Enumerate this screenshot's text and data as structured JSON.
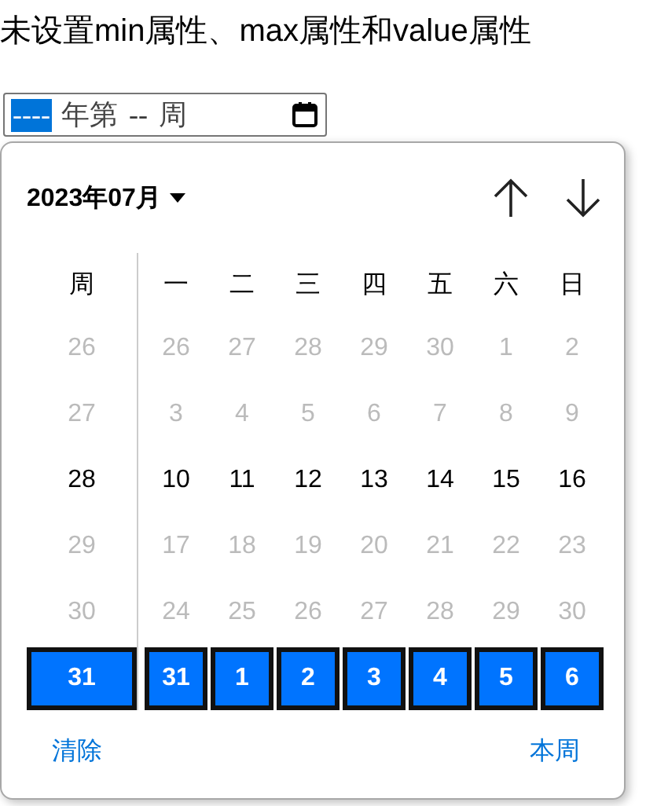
{
  "heading": "未设置min属性、max属性和value属性",
  "week_input": {
    "segments": [
      {
        "kind": "field",
        "text": "----",
        "selected": true
      },
      {
        "kind": "literal",
        "text": "年第"
      },
      {
        "kind": "field",
        "text": "--",
        "selected": false
      },
      {
        "kind": "literal",
        "text": "周"
      }
    ]
  },
  "picker": {
    "month_label": "2023年07月",
    "week_header": "周",
    "weekdays": [
      "一",
      "二",
      "三",
      "四",
      "五",
      "六",
      "日"
    ],
    "weeks": [
      {
        "week": "26",
        "days": [
          "26",
          "27",
          "28",
          "29",
          "30",
          "1",
          "2"
        ],
        "dimmed": true,
        "selected": false
      },
      {
        "week": "27",
        "days": [
          "3",
          "4",
          "5",
          "6",
          "7",
          "8",
          "9"
        ],
        "dimmed": true,
        "selected": false
      },
      {
        "week": "28",
        "days": [
          "10",
          "11",
          "12",
          "13",
          "14",
          "15",
          "16"
        ],
        "dimmed": false,
        "selected": false
      },
      {
        "week": "29",
        "days": [
          "17",
          "18",
          "19",
          "20",
          "21",
          "22",
          "23"
        ],
        "dimmed": true,
        "selected": false
      },
      {
        "week": "30",
        "days": [
          "24",
          "25",
          "26",
          "27",
          "28",
          "29",
          "30"
        ],
        "dimmed": true,
        "selected": false
      },
      {
        "week": "31",
        "days": [
          "31",
          "1",
          "2",
          "3",
          "4",
          "5",
          "6"
        ],
        "dimmed": false,
        "selected": true
      }
    ],
    "clear_button": "清除",
    "this_week_button": "本周"
  }
}
